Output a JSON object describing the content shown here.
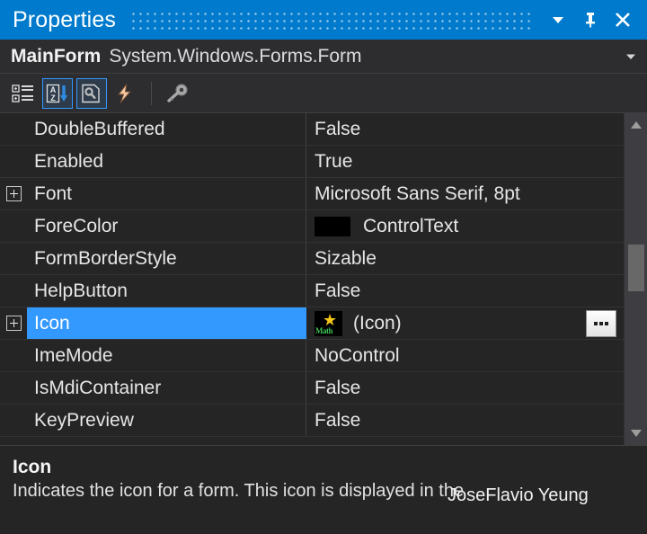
{
  "titlebar": {
    "title": "Properties",
    "buttons": [
      {
        "name": "window-menu-chevron",
        "icon": "chevron-down-icon"
      },
      {
        "name": "pin-button",
        "icon": "pin-icon"
      },
      {
        "name": "close-button",
        "icon": "close-icon"
      }
    ]
  },
  "object_selector": {
    "name": "MainForm",
    "type": "System.Windows.Forms.Form",
    "chevron": "chevron-down-icon"
  },
  "toolbar": {
    "items": [
      {
        "name": "categorized-button",
        "icon": "categorized-icon",
        "active": false
      },
      {
        "name": "alphabetical-button",
        "icon": "sort-az-icon",
        "active": true
      },
      {
        "name": "properties-button",
        "icon": "properties-page-icon",
        "active": true
      },
      {
        "name": "events-button",
        "icon": "lightning-icon",
        "active": false
      },
      {
        "name": "property-pages-button",
        "icon": "wrench-key-icon",
        "active": false
      }
    ]
  },
  "grid": {
    "rows": [
      {
        "expandable": false,
        "name": "DoubleBuffered",
        "value": "False",
        "type": "text",
        "selected": false
      },
      {
        "expandable": false,
        "name": "Enabled",
        "value": "True",
        "type": "text",
        "selected": false
      },
      {
        "expandable": true,
        "name": "Font",
        "value": "Microsoft Sans Serif, 8pt",
        "type": "text",
        "selected": false
      },
      {
        "expandable": false,
        "name": "ForeColor",
        "value": "ControlText",
        "type": "color",
        "swatch": "#000000",
        "selected": false
      },
      {
        "expandable": false,
        "name": "FormBorderStyle",
        "value": "Sizable",
        "type": "text",
        "selected": false
      },
      {
        "expandable": false,
        "name": "HelpButton",
        "value": "False",
        "type": "text",
        "selected": false
      },
      {
        "expandable": true,
        "name": "Icon",
        "value": "(Icon)",
        "type": "icon",
        "icon_caption": "Math",
        "selected": true,
        "has_ellipsis": true
      },
      {
        "expandable": false,
        "name": "ImeMode",
        "value": "NoControl",
        "type": "text",
        "selected": false
      },
      {
        "expandable": false,
        "name": "IsMdiContainer",
        "value": "False",
        "type": "text",
        "selected": false
      },
      {
        "expandable": false,
        "name": "KeyPreview",
        "value": "False",
        "type": "text",
        "selected": false
      }
    ],
    "ellipsis_label": "..."
  },
  "scrollbar": {
    "up_arrow": "scroll-up-icon",
    "down_arrow": "scroll-down-icon"
  },
  "description": {
    "title": "Icon",
    "text": "Indicates the icon for a form. This icon is displayed in the",
    "watermark": "JoseFlavio Yeung"
  },
  "colors": {
    "accent": "#007ACC",
    "selection": "#3399FF",
    "panel_bg": "#252526",
    "toolbar_bg": "#2D2D30"
  }
}
